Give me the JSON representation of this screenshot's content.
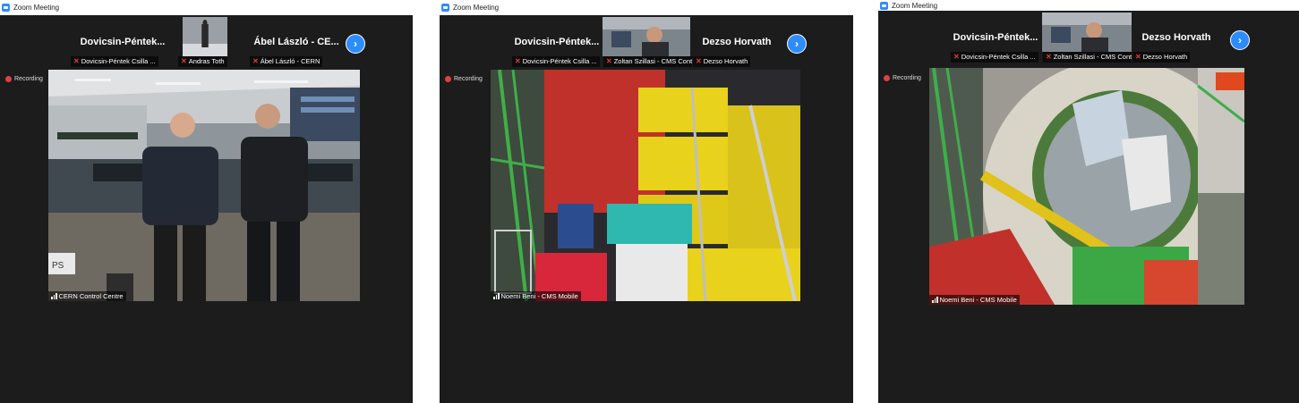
{
  "colors": {
    "zoom_blue": "#2d8cff",
    "panel": "#1c1c1c",
    "recording_dot": "#e04040",
    "muted_mic": "#e53935"
  },
  "icons": {
    "app": "zoom-icon",
    "next": "chevron-right-icon",
    "recording": "record-dot-icon",
    "mic_muted": "mic-off-icon",
    "signal": "signal-bars-icon"
  },
  "windows": [
    {
      "title": "Zoom Meeting",
      "recording_label": "Recording",
      "thumbnails": [
        {
          "name": "Dovicsin-Péntek...",
          "caption": "Dovicsin-Péntek Csilla ..."
        },
        {
          "caption": "Andras Toth"
        },
        {
          "name": "Ábel László - CE...",
          "caption": "Ábel László - CERN"
        }
      ],
      "speaker": "CERN Control Centre",
      "scene_sign": "PS"
    },
    {
      "title": "Zoom Meeting",
      "recording_label": "Recording",
      "thumbnails": [
        {
          "name": "Dovicsin-Péntek...",
          "caption": "Dovicsin-Péntek Csilla ..."
        },
        {
          "caption": "Zoltan Szillasi - CMS Cont..."
        },
        {
          "name": "Dezso Horvath",
          "caption": "Dezso Horvath"
        }
      ],
      "speaker": "Noemi Beni - CMS Mobile"
    },
    {
      "title": "Zoom Meeting",
      "recording_label": "Recording",
      "thumbnails": [
        {
          "name": "Dovicsin-Péntek...",
          "caption": "Dovicsin-Péntek Csilla ..."
        },
        {
          "caption": "Zoltan Szillasi - CMS Cont..."
        },
        {
          "name": "Dezso Horvath",
          "caption": "Dezso Horvath"
        }
      ],
      "speaker": "Noemi Beni - CMS Mobile"
    }
  ]
}
